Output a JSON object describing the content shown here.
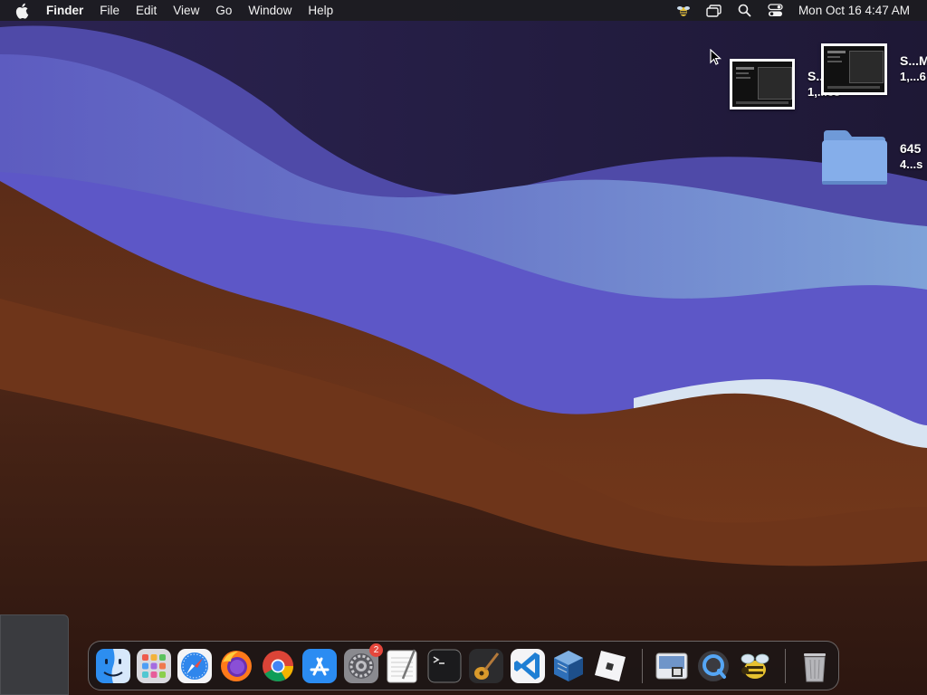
{
  "menubar": {
    "app_name": "Finder",
    "menus": [
      "File",
      "Edit",
      "View",
      "Go",
      "Window",
      "Help"
    ],
    "clock": "Mon Oct 16  4:47 AM",
    "status_icons": [
      "bee-icon",
      "screen-mirroring-icon",
      "search-icon",
      "control-center-icon"
    ]
  },
  "desktop": {
    "items": [
      {
        "name": "S...M",
        "sub": "1,...68"
      },
      {
        "name": "S...M",
        "sub": "1,...6"
      },
      {
        "name": "645",
        "sub": "4...s"
      }
    ]
  },
  "dock": {
    "apps": [
      "Finder",
      "Launchpad",
      "Safari",
      "Firefox",
      "Chrome",
      "App Store",
      "System Settings",
      "TextEdit",
      "Terminal",
      "GarageBand",
      "Visual Studio Code",
      "VirtualBox",
      "Roblox",
      "Preview",
      "QuickTime Player",
      "Honey Bee",
      "Trash"
    ],
    "settings_badge": "2"
  },
  "colors": {
    "menubar_bg": "#1c1c20",
    "wave_dark": "#1f1736",
    "wave_blue": "#5f57bd",
    "wave_light": "#7aa2d6",
    "wave_brown": "#6e3a1d",
    "wave_deep": "#3a1e12"
  }
}
